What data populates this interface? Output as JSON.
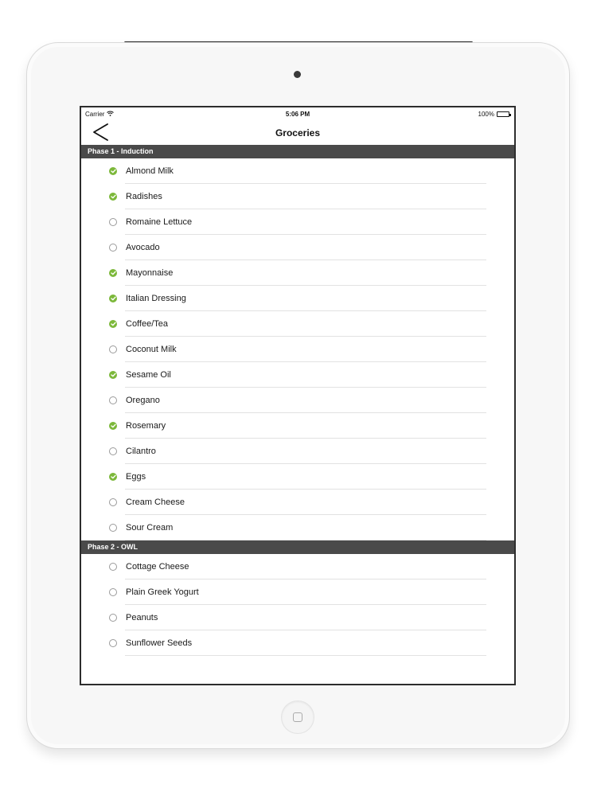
{
  "status_bar": {
    "carrier": "Carrier",
    "time": "5:06 PM",
    "battery": "100%"
  },
  "nav": {
    "title": "Groceries",
    "back_icon": "chevron-left-icon"
  },
  "colors": {
    "checked": "#7cb83a",
    "section_header": "#4a4a4a"
  },
  "sections": [
    {
      "title": "Phase 1 - Induction",
      "items": [
        {
          "label": "Almond Milk",
          "checked": true
        },
        {
          "label": "Radishes",
          "checked": true
        },
        {
          "label": "Romaine Lettuce",
          "checked": false
        },
        {
          "label": "Avocado",
          "checked": false
        },
        {
          "label": "Mayonnaise",
          "checked": true
        },
        {
          "label": "Italian Dressing",
          "checked": true
        },
        {
          "label": "Coffee/Tea",
          "checked": true
        },
        {
          "label": "Coconut Milk",
          "checked": false
        },
        {
          "label": "Sesame Oil",
          "checked": true
        },
        {
          "label": "Oregano",
          "checked": false
        },
        {
          "label": "Rosemary",
          "checked": true
        },
        {
          "label": "Cilantro",
          "checked": false
        },
        {
          "label": "Eggs",
          "checked": true
        },
        {
          "label": "Cream Cheese",
          "checked": false
        },
        {
          "label": "Sour Cream",
          "checked": false
        }
      ]
    },
    {
      "title": "Phase 2 - OWL",
      "items": [
        {
          "label": "Cottage Cheese",
          "checked": false
        },
        {
          "label": "Plain Greek Yogurt",
          "checked": false
        },
        {
          "label": "Peanuts",
          "checked": false
        },
        {
          "label": "Sunflower Seeds",
          "checked": false
        }
      ]
    }
  ]
}
